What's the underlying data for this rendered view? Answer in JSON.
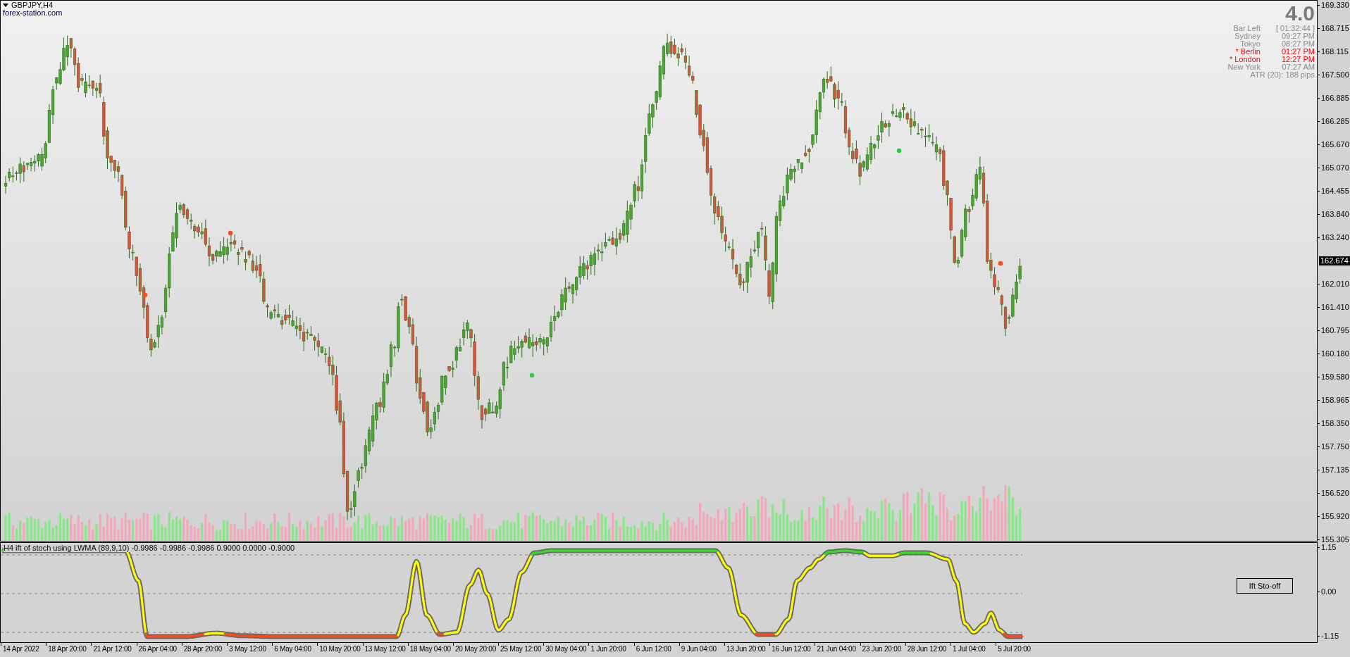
{
  "chart": {
    "symbol": "GBPJPY,H4",
    "source_label": "forex-station.com"
  },
  "info_panel": {
    "version": "4.0",
    "rows": [
      {
        "label": "Bar Left",
        "value": "[ 01:32:44 ]",
        "highlighted": false
      },
      {
        "label": "Sydney",
        "value": "09:27 PM",
        "highlighted": false
      },
      {
        "label": "Tokyo",
        "value": "08:27 PM",
        "highlighted": false
      },
      {
        "label": "* Berlin",
        "value": "01:27 PM",
        "highlighted": true
      },
      {
        "label": "* London",
        "value": "12:27 PM",
        "highlighted": true
      },
      {
        "label": "New York",
        "value": "07:27 AM",
        "highlighted": false
      }
    ],
    "atr": "ATR (20): 188 pips"
  },
  "price_axis": {
    "labels": [
      {
        "kind": "tick",
        "text": "169.330"
      },
      {
        "kind": "tick",
        "text": "168.715"
      },
      {
        "kind": "tick",
        "text": "168.115"
      },
      {
        "kind": "tick",
        "text": "167.500"
      },
      {
        "kind": "tick",
        "text": "166.885"
      },
      {
        "kind": "tick",
        "text": "166.285"
      },
      {
        "kind": "tick",
        "text": "165.670"
      },
      {
        "kind": "tick",
        "text": "165.070"
      },
      {
        "kind": "tick",
        "text": "164.455"
      },
      {
        "kind": "tick",
        "text": "163.840"
      },
      {
        "kind": "tick",
        "text": "163.240"
      },
      {
        "kind": "current",
        "text": "162.674"
      },
      {
        "kind": "tick",
        "text": "162.010"
      },
      {
        "kind": "tick",
        "text": "161.410"
      },
      {
        "kind": "tick",
        "text": "160.795"
      },
      {
        "kind": "tick",
        "text": "160.180"
      },
      {
        "kind": "tick",
        "text": "159.580"
      },
      {
        "kind": "tick",
        "text": "158.965"
      },
      {
        "kind": "tick",
        "text": "158.350"
      },
      {
        "kind": "tick",
        "text": "157.750"
      },
      {
        "kind": "tick",
        "text": "157.135"
      },
      {
        "kind": "tick",
        "text": "156.520"
      },
      {
        "kind": "tick",
        "text": "155.920"
      },
      {
        "kind": "tick",
        "text": "155.305"
      }
    ]
  },
  "indicator": {
    "legend": "H4 ift of stoch using LWMA (89,9,10) -0.9986 -0.9986 -0.9986 0.9000 0.0000 -0.9000",
    "button": "Ift Sto-off",
    "axis_labels": [
      "1.15",
      "0.00",
      "-1.15"
    ]
  },
  "time_axis": {
    "labels": [
      "14 Apr 2022",
      "18 Apr 20:00",
      "21 Apr 12:00",
      "26 Apr 04:00",
      "28 Apr 20:00",
      "3 May 12:00",
      "6 May 04:00",
      "10 May 20:00",
      "13 May 12:00",
      "18 May 04:00",
      "20 May 20:00",
      "25 May 12:00",
      "30 May 04:00",
      "1 Jun 20:00",
      "6 Jun 12:00",
      "9 Jun 04:00",
      "13 Jun 20:00",
      "16 Jun 12:00",
      "21 Jun 04:00",
      "23 Jun 20:00",
      "28 Jun 12:00",
      "1 Jul 04:00",
      "5 Jul 20:00"
    ]
  }
}
